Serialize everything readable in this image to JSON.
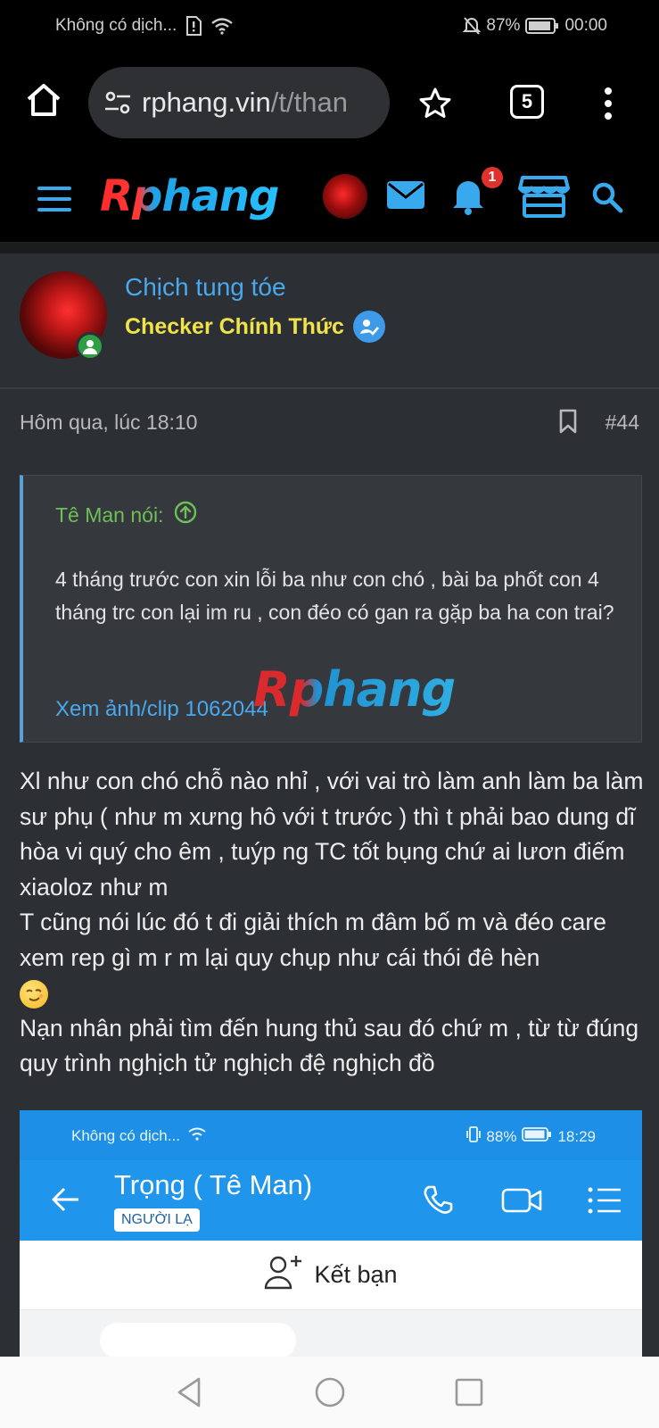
{
  "status_bar": {
    "carrier": "Không có dịch...",
    "battery": "87%",
    "time": "00:00"
  },
  "browser": {
    "url_host": "rphang.vin",
    "url_path": "/t/than",
    "tab_count": "5"
  },
  "site_header": {
    "logo_text": "Rphang",
    "notification_count": "1"
  },
  "post": {
    "username": "Chịch tung tóe",
    "user_title": "Checker Chính Thức",
    "timestamp": "Hôm qua, lúc 18:10",
    "post_number": "#44",
    "quote": {
      "author": "Tê Man nói:",
      "text": "4 tháng trước con xin lỗi ba như con chó , bài ba phốt con 4 tháng trc con lại im ru , con đéo có gan ra gặp ba ha con trai?",
      "link": "Xem ảnh/clip 1062044",
      "watermark": "Rphang"
    },
    "body": {
      "line1": "Xl như con chó chỗ nào nhỉ , với vai trò làm anh làm ba làm sư phụ ( như m xưng hô với t trước ) thì t phải bao dung dĩ hòa vi quý cho êm , tuýp ng TC tốt bụng chứ ai lươn điếm xiaoloz như m",
      "line2": "T cũng nói lúc đó t đi giải thích m đâm bố m và đéo care xem rep gì m r m lại quy chụp như cái thói đê hèn",
      "line3": "Nạn nhân phải tìm đến hung thủ sau đó chứ m , từ từ đúng quy trình nghịch tử nghịch đệ nghịch đồ"
    },
    "embedded_screenshot": {
      "carrier": "Không có dịch...",
      "battery": "88%",
      "time": "18:29",
      "contact_name": "Trọng ( Tê Man)",
      "contact_tag": "NGƯỜI LẠ",
      "add_friend_label": "Kết bạn"
    }
  },
  "colors": {
    "page_bg": "#1b1c1e",
    "post_bg": "#2c2f33",
    "link_blue": "#4aa8ec",
    "title_yellow": "#f0e34a",
    "quote_green": "#6fbf57",
    "header_icon": "#39a9ee"
  }
}
